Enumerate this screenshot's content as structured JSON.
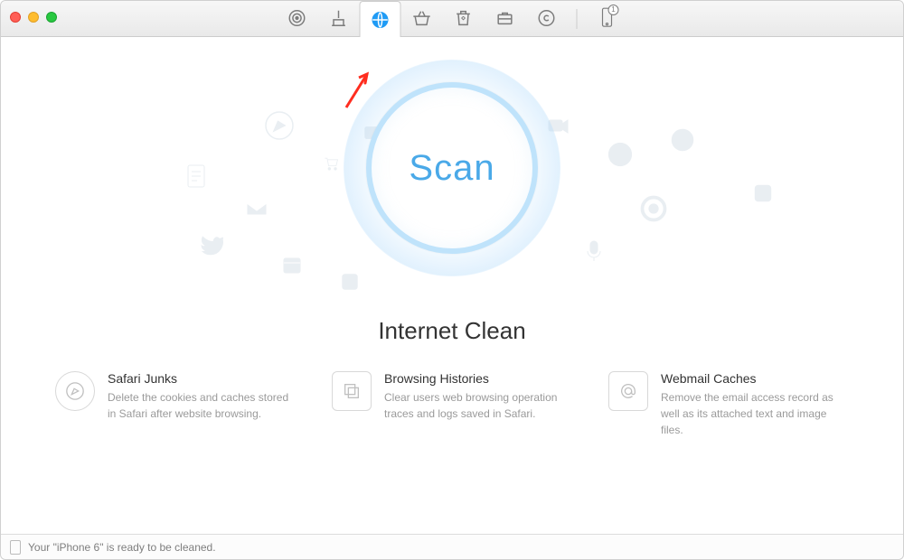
{
  "toolbar": {
    "tabs": [
      {
        "name": "target-tab",
        "icon": "target-icon"
      },
      {
        "name": "sweep-tab",
        "icon": "broom-icon"
      },
      {
        "name": "internet-tab",
        "icon": "globe-icon",
        "active": true
      },
      {
        "name": "basket-tab",
        "icon": "basket-icon"
      },
      {
        "name": "trash-tab",
        "icon": "recycle-icon"
      },
      {
        "name": "toolbox-tab",
        "icon": "briefcase-icon"
      },
      {
        "name": "copyright-tab",
        "icon": "copyright-icon"
      }
    ],
    "device_badge": "1"
  },
  "scan": {
    "button_label": "Scan",
    "section_title": "Internet Clean"
  },
  "features": [
    {
      "icon": "compass-icon",
      "title": "Safari Junks",
      "desc": "Delete the cookies and caches stored in Safari after website browsing."
    },
    {
      "icon": "windows-icon",
      "title": "Browsing Histories",
      "desc": "Clear users web browsing operation traces and logs saved in Safari."
    },
    {
      "icon": "at-icon",
      "title": "Webmail Caches",
      "desc": "Remove the email access record as well as its attached text and image files."
    }
  ],
  "statusbar": {
    "message": "Your \"iPhone 6\" is ready to be cleaned."
  },
  "colors": {
    "accent": "#1f9bf5",
    "scan_text": "#4aa9e8",
    "annotation_arrow": "#ff2d1f"
  }
}
